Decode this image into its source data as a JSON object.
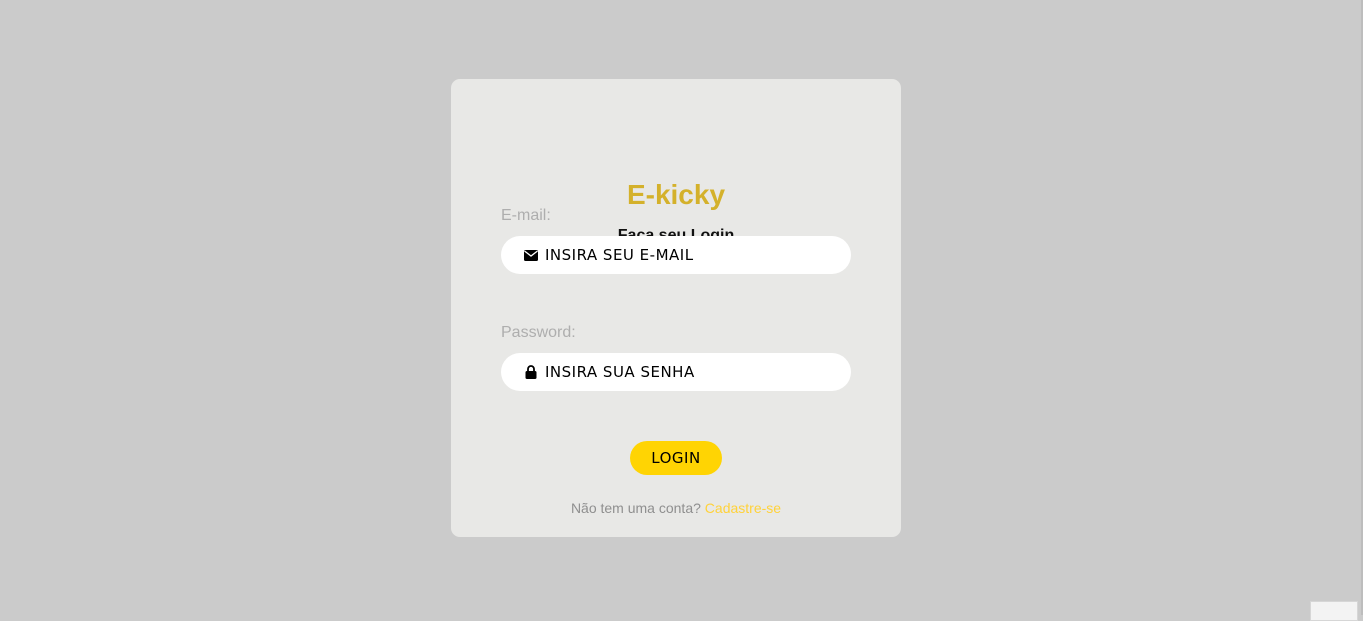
{
  "login": {
    "brand": "E-kicky",
    "subtitle": "Faça seu Login",
    "email": {
      "label": "E-mail:",
      "placeholder": "INSIRA SEU E-MAIL",
      "value": "",
      "icon": "envelope-icon"
    },
    "password": {
      "label": "Password:",
      "placeholder": "INSIRA SUA SENHA",
      "value": "",
      "icon": "lock-icon"
    },
    "submit_label": "LOGIN",
    "signup_prompt": "Não tem uma conta?",
    "signup_link": "Cadastre-se"
  },
  "colors": {
    "page_bg": "#cbcbcb",
    "card_bg": "#e8e8e6",
    "brand": "#d4b12b",
    "button": "#ffd403",
    "link": "#ffd23a"
  }
}
